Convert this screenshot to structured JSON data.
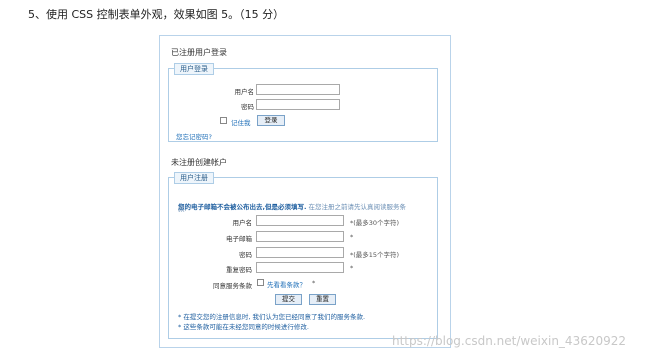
{
  "question": "5、使用 CSS 控制表单外观，效果如图 5。（15 分）",
  "login": {
    "section_title": "已注册用户登录",
    "legend": "用户登录",
    "username_label": "用户名",
    "password_label": "密码",
    "remember_label": "记住我",
    "login_button": "登录",
    "forgot_link": "您忘记密码?"
  },
  "register": {
    "section_title": "未注册创建帐户",
    "legend": "用户注册",
    "notice_bold": "您的电子邮箱不会被公布出去,但是必须填写.",
    "notice_light": " 在您注册之前请先认真阅读服务条",
    "notice_light2": "款.",
    "username_label": "用户名",
    "username_hint": "*(最多30个字符)",
    "email_label": "电子邮箱",
    "email_hint": "*",
    "password_label": "密码",
    "password_hint": "*(最多15个字符)",
    "repeat_label": "重复密码",
    "repeat_hint": "*",
    "terms_label": "同意服务条款",
    "terms_link": "先看看条款？",
    "terms_star": "*",
    "submit_button": "提交",
    "reset_button": "重置",
    "footer_1": "* 在提交您的注册信息时, 我们认为您已经同意了我们的服务条款.",
    "footer_2": "* 这些条款可能在未经您同意的时候进行修改."
  },
  "watermark": "https://blog.csdn.net/weixin_43620922"
}
